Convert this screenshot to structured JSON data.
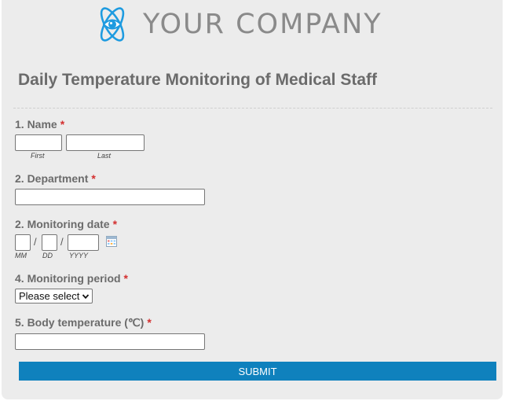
{
  "header": {
    "company_name": "YOUR COMPANY",
    "logo_icon": "atom-eye-logo",
    "logo_color": "#1e9be0"
  },
  "form": {
    "title": "Daily Temperature Monitoring of Medical Staff",
    "required_marker": "*",
    "q1": {
      "label": "1. Name",
      "first_value": "",
      "last_value": "",
      "first_sublabel": "First",
      "last_sublabel": "Last"
    },
    "q2": {
      "label": "2. Department",
      "value": ""
    },
    "q3": {
      "label": "2. Monitoring date",
      "mm_value": "",
      "dd_value": "",
      "yyyy_value": "",
      "separator": "/",
      "mm_sublabel": "MM",
      "dd_sublabel": "DD",
      "yyyy_sublabel": "YYYY",
      "calendar_icon": "calendar-icon"
    },
    "q4": {
      "label": "4. Monitoring period",
      "selected": "Please select"
    },
    "q5": {
      "label": "5. Body temperature (℃)",
      "value": ""
    },
    "submit_label": "SUBMIT"
  },
  "colors": {
    "accent": "#0f81bd",
    "required": "#d32f2f",
    "label": "#6b6b6b",
    "background": "#ececec"
  }
}
